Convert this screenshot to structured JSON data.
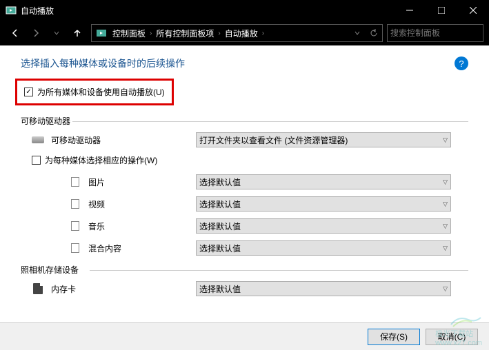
{
  "titlebar": {
    "title": "自动播放"
  },
  "breadcrumb": {
    "item1": "控制面板",
    "item2": "所有控制面板项",
    "item3": "自动播放"
  },
  "search": {
    "placeholder": "搜索控制面板"
  },
  "page": {
    "title": "选择插入每种媒体或设备时的后续操作",
    "help": "?"
  },
  "main_checkbox": {
    "label": "为所有媒体和设备使用自动播放(U)"
  },
  "section1": {
    "label": "可移动驱动器",
    "drive": {
      "label": "可移动驱动器",
      "value": "打开文件夹以查看文件 (文件资源管理器)"
    },
    "sub_checkbox": {
      "label": "为每种媒体选择相应的操作(W)"
    },
    "pictures": {
      "label": "图片",
      "value": "选择默认值"
    },
    "videos": {
      "label": "视频",
      "value": "选择默认值"
    },
    "music": {
      "label": "音乐",
      "value": "选择默认值"
    },
    "mixed": {
      "label": "混合内容",
      "value": "选择默认值"
    }
  },
  "section2": {
    "label": "照相机存储设备",
    "memcard": {
      "label": "内存卡",
      "value": "选择默认值"
    }
  },
  "footer": {
    "save": "保存(S)",
    "cancel": "取消(C)"
  },
  "watermark": {
    "text": "www.x27.com",
    "brand": "极光下载站"
  }
}
